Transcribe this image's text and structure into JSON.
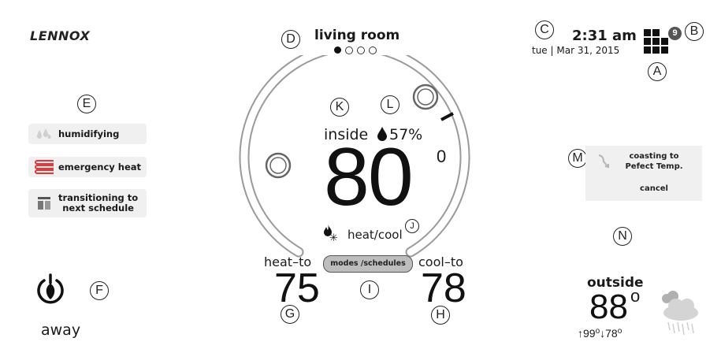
{
  "brand": {
    "logo_text": "LENNOX"
  },
  "header": {
    "room_name": "living room",
    "page_dots": 4,
    "active_dot": 0,
    "time": "2:31 am",
    "date": "tue | Mar 31, 2015",
    "menu_badge": "9"
  },
  "status": [
    {
      "label": "humidifying",
      "icon": "droplets-icon"
    },
    {
      "label": "emergency heat",
      "icon": "heat-coil-icon"
    },
    {
      "label": "transitioning to next schedule",
      "label_line1": "transitioning to",
      "label_line2": "next schedule",
      "icon": "schedule-icon"
    }
  ],
  "away": {
    "label": "away",
    "icon": "leaf-power-icon"
  },
  "indoor": {
    "inside_label": "inside",
    "humidity": "57%",
    "temperature": "80",
    "degree": "0",
    "mode_label": "heat/cool"
  },
  "setpoints": {
    "heat_label": "heat–to",
    "heat_value": "75",
    "cool_label": "cool–to",
    "cool_value": "78",
    "modes_button": "modes /schedules"
  },
  "coasting": {
    "line1": "coasting to",
    "line2": "Pefect Temp.",
    "cancel": "cancel"
  },
  "outside": {
    "label": "outside",
    "temperature": "88",
    "degree": "o",
    "high": "99",
    "low": "78",
    "deg_small": "o",
    "weather_icon": "rain-cloud-icon"
  },
  "callouts": {
    "A": "A",
    "B": "B",
    "C": "C",
    "D": "D",
    "E": "E",
    "F": "F",
    "G": "G",
    "H": "H",
    "I": "I",
    "J": "J",
    "K": "K",
    "L": "L",
    "M": "M",
    "N": "N"
  },
  "colors": {
    "accent_red": "#e0393e",
    "panel_gray": "#f0f0f0",
    "ring_gray": "#9a9a9a"
  }
}
